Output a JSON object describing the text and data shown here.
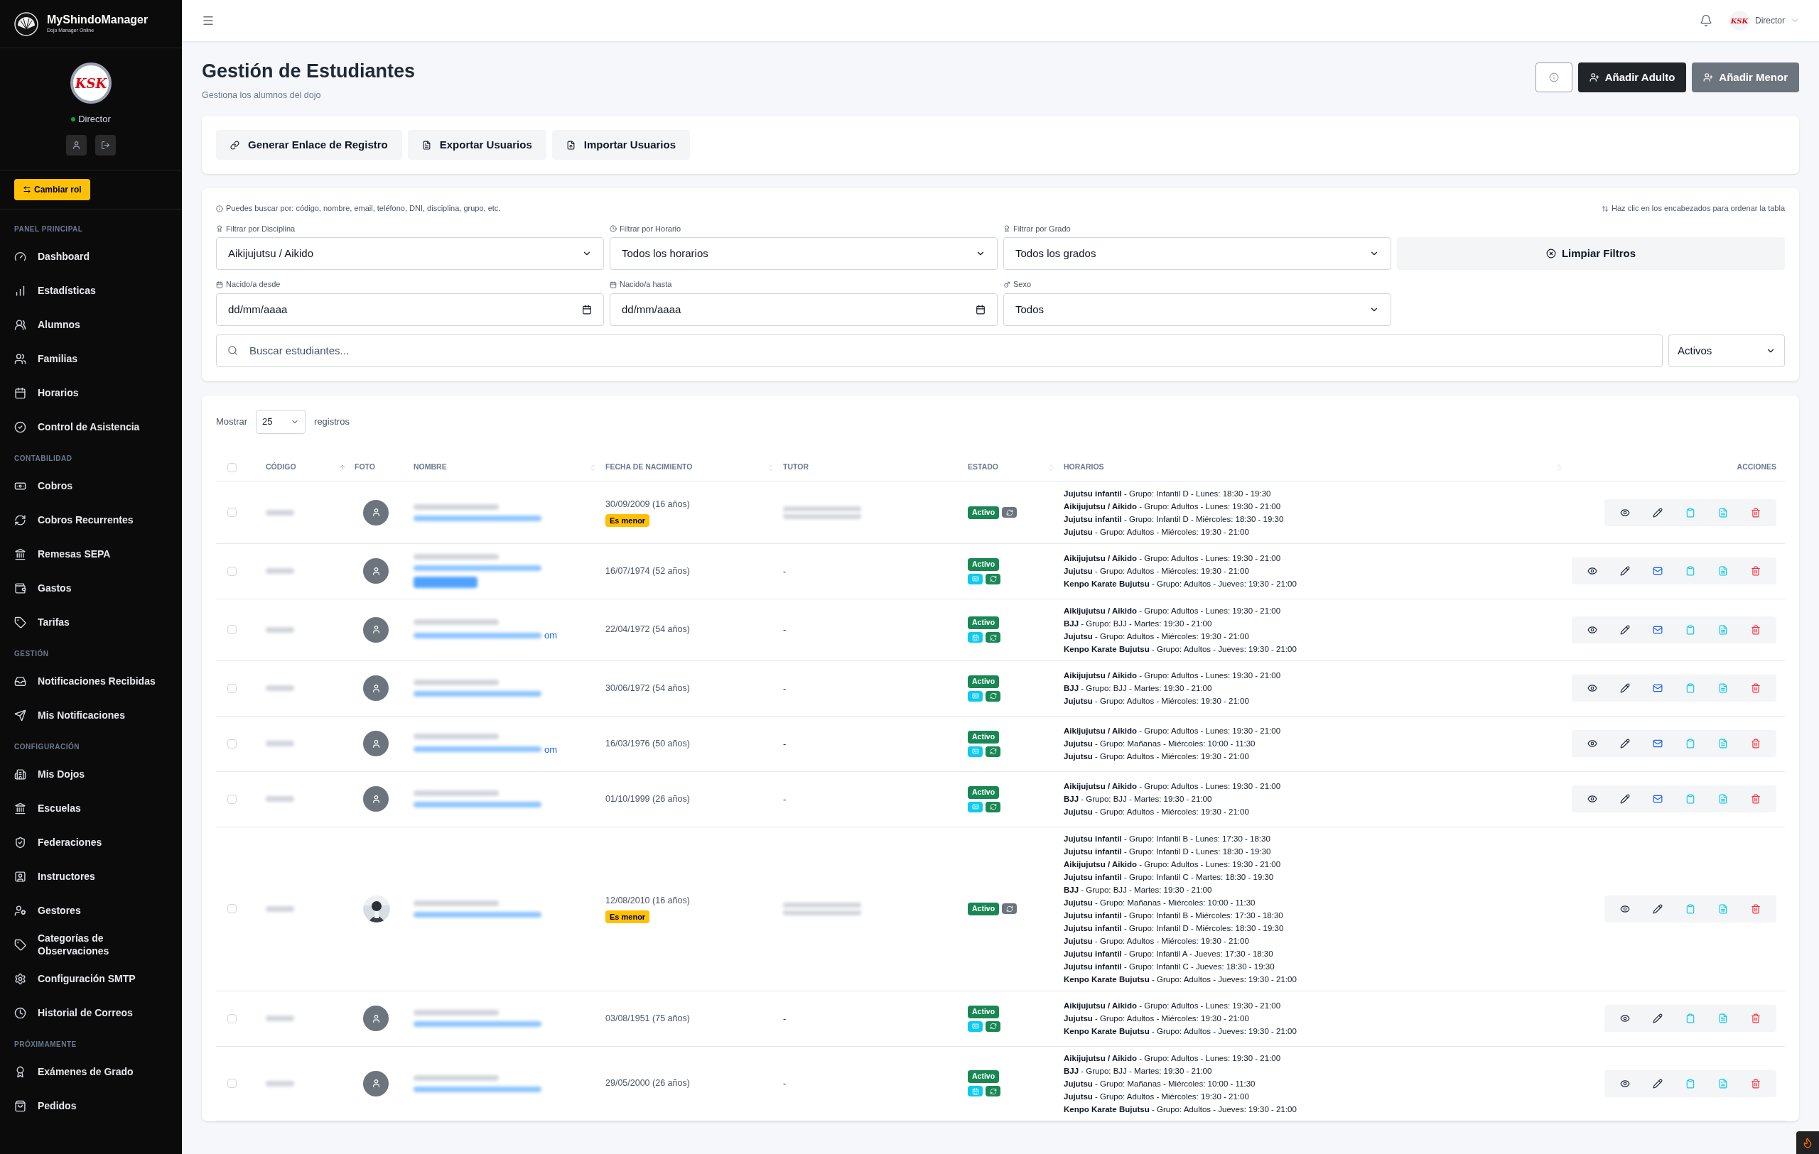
{
  "sidebar": {
    "brand": {
      "name": "MyShindoManager",
      "tagline": "Dojo Manager Online"
    },
    "profile": {
      "logo_text": "KSK",
      "role": "Director",
      "online": true
    },
    "switch_role": "Cambiar rol",
    "sections": [
      {
        "title": "PANEL PRINCIPAL",
        "items": [
          {
            "label": "Dashboard"
          },
          {
            "label": "Estadísticas"
          },
          {
            "label": "Alumnos"
          },
          {
            "label": "Familias"
          },
          {
            "label": "Horarios"
          },
          {
            "label": "Control de Asistencia"
          }
        ]
      },
      {
        "title": "CONTABILIDAD",
        "items": [
          {
            "label": "Cobros"
          },
          {
            "label": "Cobros Recurrentes"
          },
          {
            "label": "Remesas SEPA"
          },
          {
            "label": "Gastos"
          },
          {
            "label": "Tarifas"
          }
        ]
      },
      {
        "title": "GESTIÓN",
        "items": [
          {
            "label": "Notificaciones Recibidas"
          },
          {
            "label": "Mis Notificaciones"
          }
        ]
      },
      {
        "title": "CONFIGURACIÓN",
        "items": [
          {
            "label": "Mis Dojos"
          },
          {
            "label": "Escuelas"
          },
          {
            "label": "Federaciones"
          },
          {
            "label": "Instructores"
          },
          {
            "label": "Gestores"
          },
          {
            "label": "Categorías de Observaciones"
          },
          {
            "label": "Configuración SMTP"
          },
          {
            "label": "Historial de Correos"
          }
        ]
      },
      {
        "title": "PRÓXIMAMENTE",
        "items": [
          {
            "label": "Exámenes de Grado"
          },
          {
            "label": "Pedidos"
          }
        ]
      }
    ]
  },
  "topbar": {
    "user": "Director",
    "logo_text": "KSK"
  },
  "page": {
    "title": "Gestión de Estudiantes",
    "subtitle": "Gestiona los alumnos del dojo",
    "buttons": [
      {
        "label": "Añadir Adulto",
        "kind": "primary"
      },
      {
        "label": "Añadir Menor",
        "kind": "secondary"
      }
    ]
  },
  "tools": [
    "Generar Enlace de Registro",
    "Exportar Usuarios",
    "Importar Usuarios"
  ],
  "filters": {
    "hint": "Puedes buscar por: código, nombre, email, teléfono, DNI, disciplina, grupo, etc.",
    "sort_hint": "Haz clic en los encabezados para ordenar la tabla",
    "fields": [
      {
        "label": "Filtrar por Disciplina",
        "value": "Aikijujutsu / Aikido",
        "kind": "select"
      },
      {
        "label": "Filtrar por Horario",
        "value": "Todos los horarios",
        "kind": "select"
      },
      {
        "label": "Filtrar por Grado",
        "value": "Todos los grados",
        "kind": "select"
      },
      {
        "label": "Nacido/a desde",
        "value": "dd/mm/aaaa",
        "kind": "date"
      },
      {
        "label": "Nacido/a hasta",
        "value": "dd/mm/aaaa",
        "kind": "date"
      },
      {
        "label": "Sexo",
        "value": "Todos",
        "kind": "select"
      }
    ],
    "clear": "Limpiar Filtros",
    "search": {
      "placeholder": "Buscar estudiantes..."
    },
    "status": "Activos"
  },
  "table": {
    "show_label": "Mostrar",
    "page_size": "25",
    "records_label": "registros",
    "all_checked": false,
    "columns": [
      {
        "label": "CÓDIGO",
        "kind": "sorted-asc"
      },
      {
        "label": "FOTO",
        "kind": "plain"
      },
      {
        "label": "NOMBRE",
        "kind": "sortable"
      },
      {
        "label": "FECHA DE NACIMIENTO",
        "kind": "sortable"
      },
      {
        "label": "TUTOR",
        "kind": "plain"
      },
      {
        "label": "ESTADO",
        "kind": "sortable"
      },
      {
        "label": "HORARIOS",
        "kind": "sortable"
      },
      {
        "label": "ACCIONES",
        "kind": "plain"
      }
    ],
    "rows": [
      {
        "checked": false,
        "photo": {
          "kind": "placeholder"
        },
        "name_tag": false,
        "birth": "30/09/2009 (16 años)",
        "badge": "Es menor",
        "tutor": {
          "kind": "blurred"
        },
        "status": "Activo",
        "flags": [
          {
            "kind": "sync-gray"
          }
        ],
        "email": false,
        "schedules": [
          "**Jujutsu infantil** - Grupo: Infantil D - Lunes: 18:30 - 19:30",
          "**Aikijujutsu / Aikido** - Grupo: Adultos - Lunes: 19:30 - 21:00",
          "**Jujutsu infantil** - Grupo: Infantil D - Miércoles: 18:30 - 19:30",
          "**Jujutsu** - Grupo: Adultos - Miércoles: 19:30 - 21:00"
        ]
      },
      {
        "checked": false,
        "photo": {
          "kind": "placeholder"
        },
        "name_tag": true,
        "birth": "16/07/1974 (52 años)",
        "tutor": {
          "kind": "text",
          "text": "-"
        },
        "status": "Activo",
        "flags": [
          {
            "kind": "card"
          },
          {
            "kind": "sync"
          }
        ],
        "email": true,
        "schedules": [
          "**Aikijujutsu / Aikido** - Grupo: Adultos - Lunes: 19:30 - 21:00",
          "**Jujutsu** - Grupo: Adultos - Miércoles: 19:30 - 21:00",
          "**Kenpo Karate Bujutsu** - Grupo: Adultos - Jueves: 19:30 - 21:00"
        ]
      },
      {
        "checked": false,
        "photo": {
          "kind": "placeholder"
        },
        "name_tag": false,
        "email_tail": "om",
        "birth": "22/04/1972 (54 años)",
        "tutor": {
          "kind": "text",
          "text": "-"
        },
        "status": "Activo",
        "flags": [
          {
            "kind": "grid"
          },
          {
            "kind": "sync"
          }
        ],
        "email": true,
        "schedules": [
          "**Aikijujutsu / Aikido** - Grupo: Adultos - Lunes: 19:30 - 21:00",
          "**BJJ** - Grupo: BJJ - Martes: 19:30 - 21:00",
          "**Jujutsu** - Grupo: Adultos - Miércoles: 19:30 - 21:00",
          "**Kenpo Karate Bujutsu** - Grupo: Adultos - Jueves: 19:30 - 21:00"
        ]
      },
      {
        "checked": false,
        "photo": {
          "kind": "placeholder"
        },
        "name_tag": false,
        "birth": "30/06/1972 (54 años)",
        "tutor": {
          "kind": "text",
          "text": "-"
        },
        "status": "Activo",
        "flags": [
          {
            "kind": "card"
          },
          {
            "kind": "sync"
          }
        ],
        "email": true,
        "schedules": [
          "**Aikijujutsu / Aikido** - Grupo: Adultos - Lunes: 19:30 - 21:00",
          "**BJJ** - Grupo: BJJ - Martes: 19:30 - 21:00",
          "**Jujutsu** - Grupo: Adultos - Miércoles: 19:30 - 21:00"
        ]
      },
      {
        "checked": false,
        "photo": {
          "kind": "placeholder"
        },
        "name_tag": false,
        "email_tail": "om",
        "birth": "16/03/1976 (50 años)",
        "tutor": {
          "kind": "text",
          "text": "-"
        },
        "status": "Activo",
        "flags": [
          {
            "kind": "card"
          },
          {
            "kind": "sync"
          }
        ],
        "email": true,
        "schedules": [
          "**Aikijujutsu / Aikido** - Grupo: Adultos - Lunes: 19:30 - 21:00",
          "**Jujutsu** - Grupo: Mañanas - Miércoles: 10:00 - 11:30",
          "**Jujutsu** - Grupo: Adultos - Miércoles: 19:30 - 21:00"
        ]
      },
      {
        "checked": false,
        "photo": {
          "kind": "placeholder"
        },
        "name_tag": false,
        "birth": "01/10/1999 (26 años)",
        "tutor": {
          "kind": "text",
          "text": "-"
        },
        "status": "Activo",
        "flags": [
          {
            "kind": "card"
          },
          {
            "kind": "sync"
          }
        ],
        "email": true,
        "schedules": [
          "**Aikijujutsu / Aikido** - Grupo: Adultos - Lunes: 19:30 - 21:00",
          "**BJJ** - Grupo: BJJ - Martes: 19:30 - 21:00",
          "**Jujutsu** - Grupo: Adultos - Miércoles: 19:30 - 21:00"
        ]
      },
      {
        "checked": false,
        "photo": {
          "kind": "picture"
        },
        "name_tag": false,
        "birth": "12/08/2010 (16 años)",
        "badge": "Es menor",
        "tutor": {
          "kind": "blurred"
        },
        "status": "Activo",
        "flags": [
          {
            "kind": "sync-gray"
          }
        ],
        "email": false,
        "schedules": [
          "**Jujutsu infantil** - Grupo: Infantil B - Lunes: 17:30 - 18:30",
          "**Jujutsu infantil** - Grupo: Infantil D - Lunes: 18:30 - 19:30",
          "**Aikijujutsu / Aikido** - Grupo: Adultos - Lunes: 19:30 - 21:00",
          "**Jujutsu infantil** - Grupo: Infantil C - Martes: 18:30 - 19:30",
          "**BJJ** - Grupo: BJJ - Martes: 19:30 - 21:00",
          "**Jujutsu** - Grupo: Mañanas - Miércoles: 10:00 - 11:30",
          "**Jujutsu infantil** - Grupo: Infantil B - Miércoles: 17:30 - 18:30",
          "**Jujutsu infantil** - Grupo: Infantil D - Miércoles: 18:30 - 19:30",
          "**Jujutsu** - Grupo: Adultos - Miércoles: 19:30 - 21:00",
          "**Jujutsu infantil** - Grupo: Infantil A - Jueves: 17:30 - 18:30",
          "**Jujutsu infantil** - Grupo: Infantil C - Jueves: 18:30 - 19:30",
          "**Kenpo Karate Bujutsu** - Grupo: Adultos - Jueves: 19:30 - 21:00"
        ]
      },
      {
        "checked": false,
        "photo": {
          "kind": "placeholder"
        },
        "name_tag": false,
        "birth": "03/08/1951 (75 años)",
        "tutor": {
          "kind": "text",
          "text": "-"
        },
        "status": "Activo",
        "flags": [
          {
            "kind": "card"
          },
          {
            "kind": "sync"
          }
        ],
        "email": false,
        "schedules": [
          "**Aikijujutsu / Aikido** - Grupo: Adultos - Lunes: 19:30 - 21:00",
          "**Jujutsu** - Grupo: Adultos - Miércoles: 19:30 - 21:00",
          "**Kenpo Karate Bujutsu** - Grupo: Adultos - Jueves: 19:30 - 21:00"
        ]
      },
      {
        "checked": false,
        "photo": {
          "kind": "placeholder"
        },
        "name_tag": false,
        "birth": "29/05/2000 (26 años)",
        "tutor": {
          "kind": "text",
          "text": "-"
        },
        "status": "Activo",
        "flags": [
          {
            "kind": "grid"
          },
          {
            "kind": "sync"
          }
        ],
        "email": false,
        "schedules": [
          "**Aikijujutsu / Aikido** - Grupo: Adultos - Lunes: 19:30 - 21:00",
          "**BJJ** - Grupo: BJJ - Martes: 19:30 - 21:00",
          "**Jujutsu** - Grupo: Mañanas - Miércoles: 10:00 - 11:30",
          "**Jujutsu** - Grupo: Adultos - Miércoles: 19:30 - 21:00",
          "**Kenpo Karate Bujutsu** - Grupo: Adultos - Jueves: 19:30 - 21:00"
        ]
      }
    ]
  }
}
